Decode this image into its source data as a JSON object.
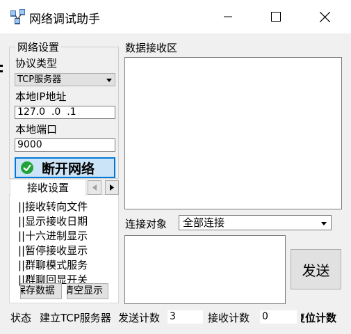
{
  "window": {
    "title": "网络调试助手",
    "minimize_icon": "minimize-icon",
    "maximize_icon": "maximize-icon",
    "close_icon": "close-icon"
  },
  "network_settings": {
    "group_title": "网络设置",
    "protocol_label": "协议类型",
    "protocol_value": "TCP服务器",
    "local_ip_label": "本地IP地址",
    "local_ip_value": "127.0  .0  .1",
    "local_port_label": "本地端口",
    "local_port_value": "9000",
    "disconnect_label": "断开网络"
  },
  "receive_settings": {
    "tab_label": "接收设置",
    "items": [
      "||接收转向文件",
      "||显示接收日期",
      "||十六进制显示",
      "||暂停接收显示",
      "||群聊模式服务",
      "||群聊回显开关"
    ],
    "save_data_label": "保存数据",
    "clear_display_label": "清空显示"
  },
  "main": {
    "receive_area_label": "数据接收区",
    "connect_target_label": "连接对象",
    "connect_target_value": "全部连接",
    "send_label": "发送"
  },
  "status_bar": {
    "status_label": "状态",
    "status_value": "建立TCP服务器",
    "send_count_label": "发送计数",
    "send_count_value": "3",
    "recv_count_label": "接收计数",
    "recv_count_value": "0",
    "reset_count_label": "复位计数"
  }
}
